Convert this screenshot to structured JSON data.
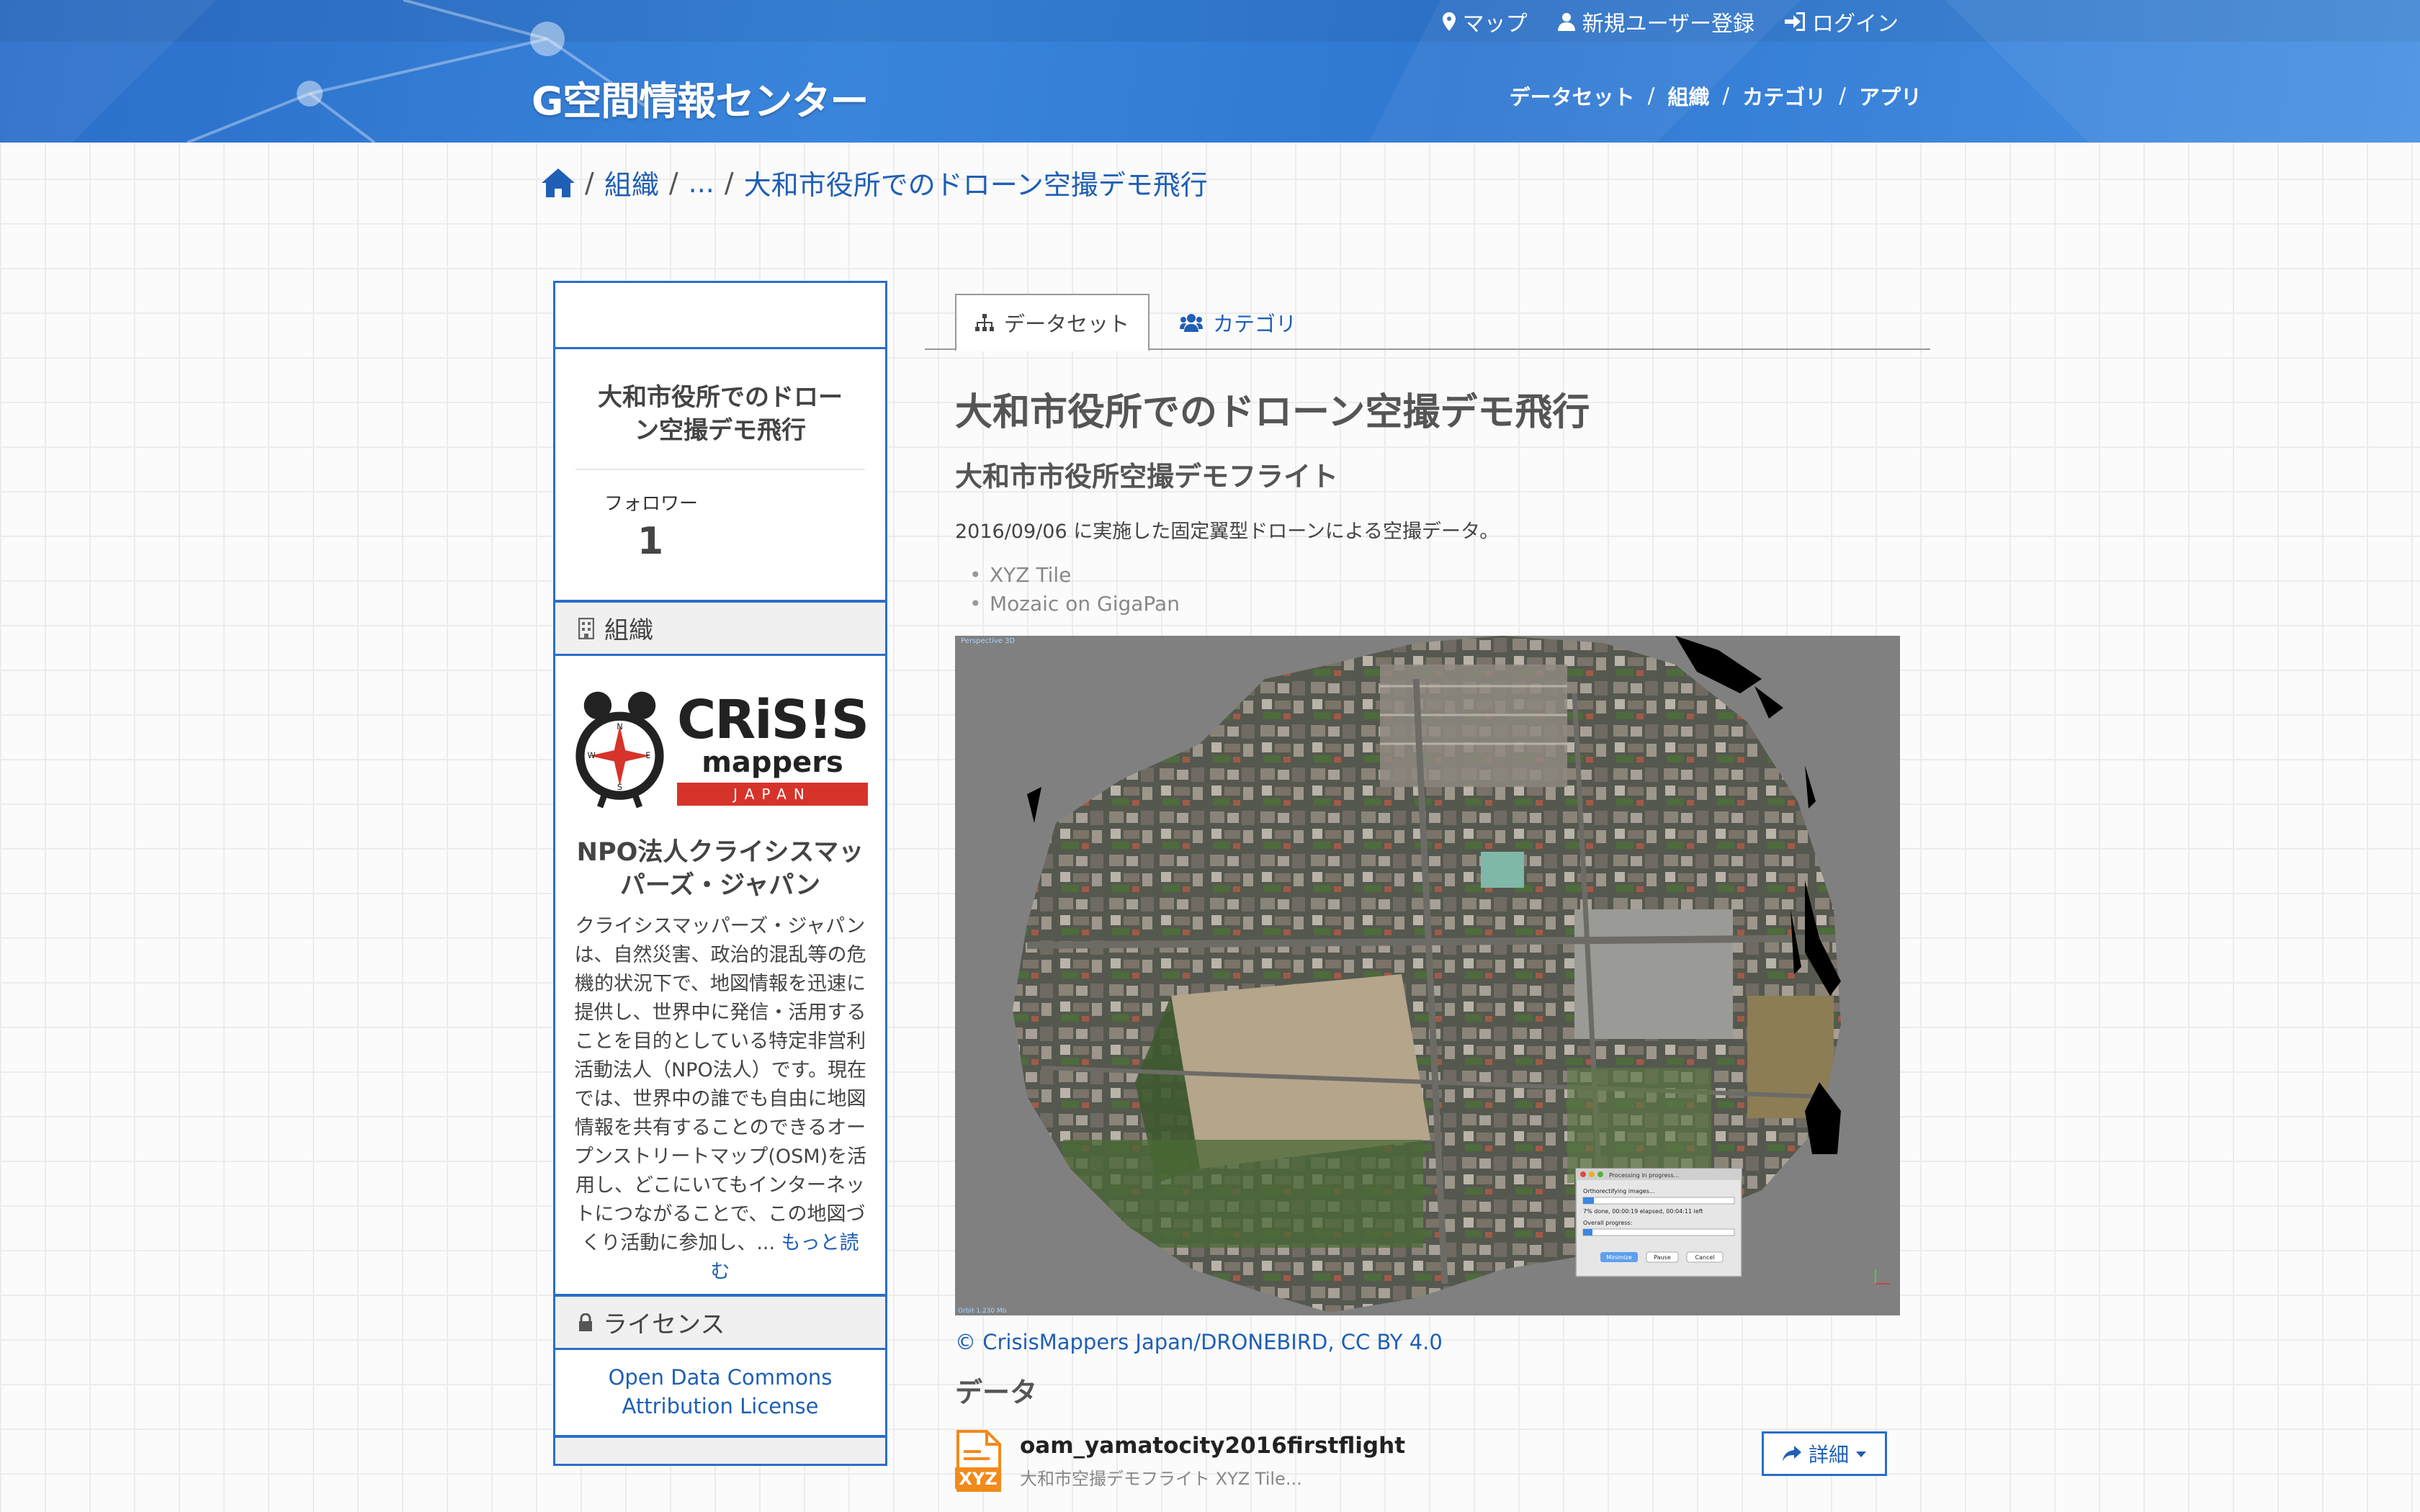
{
  "header": {
    "logo": "G空間情報センター",
    "account_links": {
      "map": "マップ",
      "register": "新規ユーザー登録",
      "login": "ログイン"
    },
    "nav": [
      "データセット",
      "組織",
      "カテゴリ",
      "アプリ"
    ]
  },
  "breadcrumb": {
    "org": "組織",
    "ellipsis": "...",
    "current": "大和市役所でのドローン空撮デモ飛行"
  },
  "sidebar": {
    "title": "大和市役所でのドローン空撮デモ飛行",
    "followers_label": "フォロワー",
    "followers_count": "1",
    "org_section_label": "組織",
    "org_logo": {
      "line1": "CRiS!S",
      "line2": "mappers",
      "line3": "JAPAN"
    },
    "org_name": "NPO法人クライシスマッパーズ・ジャパン",
    "org_description": "クライシスマッパーズ・ジャパンは、自然災害、政治的混乱等の危機的状況下で、地図情報を迅速に提供し、世界中に発信・活用することを目的としている特定非営利活動法人（NPO法人）です。現在では、世界中の誰でも自由に地図情報を共有することのできるオープンストリートマップ(OSM)を活用し、どこにいてもインターネットにつながることで、この地図づくり活動に参加し、...",
    "read_more": "もっと読む",
    "license_section_label": "ライセンス",
    "license_name": "Open Data Commons Attribution License"
  },
  "tabs": {
    "datasets": "データセット",
    "categories": "カテゴリ"
  },
  "main": {
    "title": "大和市役所でのドローン空撮デモ飛行",
    "subtitle": "大和市市役所空撮デモフライト",
    "description": "2016/09/06 に実施した固定翼型ドローンによる空撮データ。",
    "links": [
      "XYZ Tile",
      "Mozaic on GigaPan"
    ],
    "image_credit": "© CrisisMappers Japan/DRONEBIRD, CC BY 4.0",
    "data_heading": "データ",
    "resource": {
      "format_label": "XYZ",
      "name": "oam_yamatocity2016firstflight",
      "description": "大和市空撮デモフライト XYZ Tile...",
      "detail_button": "詳細"
    },
    "dialog": {
      "title": "Processing in progress...",
      "line1": "Orthorectifying images...",
      "line2": "7% done, 00:00:19 elapsed, 00:04:11 left",
      "line3": "Overall progress:",
      "btn_minimize": "Minimize",
      "btn_pause": "Pause",
      "btn_cancel": "Cancel",
      "progress_step": 0.07,
      "progress_overall": 0.06
    }
  },
  "colors": {
    "brand_blue": "#2a6ec9",
    "link_blue": "#1f5fb5",
    "japan_red": "#d6332a",
    "xyz_orange": "#f28a1c"
  }
}
